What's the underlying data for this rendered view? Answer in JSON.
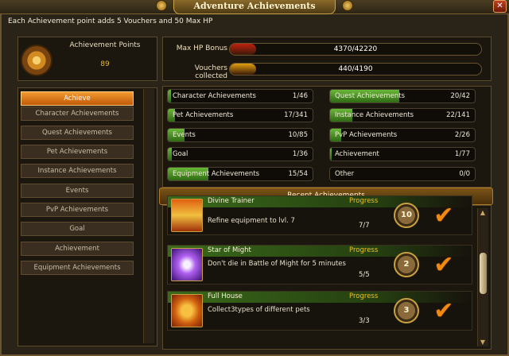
{
  "window": {
    "title": "Adventure Achievements",
    "close_label": "✕"
  },
  "info": "Each Achievement point adds 5 Vouchers and 50 Max HP",
  "points": {
    "label": "Achievement Points",
    "value": "89"
  },
  "bonus": [
    {
      "label": "Max HP Bonus",
      "value": "4370/42220",
      "progress": 0.1035,
      "color": "#c02010"
    },
    {
      "label": "Vouchers collected",
      "value": "440/4190",
      "progress": 0.105,
      "color": "#e0a010"
    }
  ],
  "sidebar": {
    "items": [
      {
        "label": "Achieve",
        "active": true
      },
      {
        "label": "Character Achievements"
      },
      {
        "label": "Quest Achievements"
      },
      {
        "label": "Pet Achievements"
      },
      {
        "label": "Instance Achievements"
      },
      {
        "label": "Events"
      },
      {
        "label": "PvP Achievements"
      },
      {
        "label": "Goal"
      },
      {
        "label": "Achievement"
      },
      {
        "label": "Equipment Achievements"
      }
    ]
  },
  "categories": [
    {
      "name": "Character Achievements",
      "value": "1/46",
      "progress": 0.022
    },
    {
      "name": "Quest Achievements",
      "value": "20/42",
      "progress": 0.476
    },
    {
      "name": "Pet Achievements",
      "value": "17/341",
      "progress": 0.05
    },
    {
      "name": "Instance Achievements",
      "value": "22/141",
      "progress": 0.156
    },
    {
      "name": "Events",
      "value": "10/85",
      "progress": 0.118
    },
    {
      "name": "PvP Achievements",
      "value": "2/26",
      "progress": 0.077
    },
    {
      "name": "Goal",
      "value": "1/36",
      "progress": 0.028
    },
    {
      "name": "Achievement",
      "value": "1/77",
      "progress": 0.013
    },
    {
      "name": "Equipment Achievements",
      "value": "15/54",
      "progress": 0.278
    },
    {
      "name": "Other",
      "value": "0/0",
      "progress": 0
    }
  ],
  "recent": {
    "header": "Recent Achievements",
    "entries": [
      {
        "title": "Divine Trainer",
        "progress_label": "Progress",
        "desc": "Refine equipment to lvl. 7",
        "count": "7/7",
        "points": "10",
        "icon": "armor-icon"
      },
      {
        "title": "Star of Might",
        "progress_label": "Progress",
        "desc": "Don't die in Battle of Might for 5 minutes",
        "count": "5/5",
        "points": "2",
        "icon": "magic-star-icon"
      },
      {
        "title": "Full House",
        "progress_label": "Progress",
        "desc": "Collect3types of different pets",
        "count": "3/3",
        "points": "3",
        "icon": "horned-helmet-icon"
      }
    ]
  },
  "colors": {
    "accent": "#e8a030",
    "progress_green": "#4a9a20",
    "text_gold": "#e8b830"
  }
}
